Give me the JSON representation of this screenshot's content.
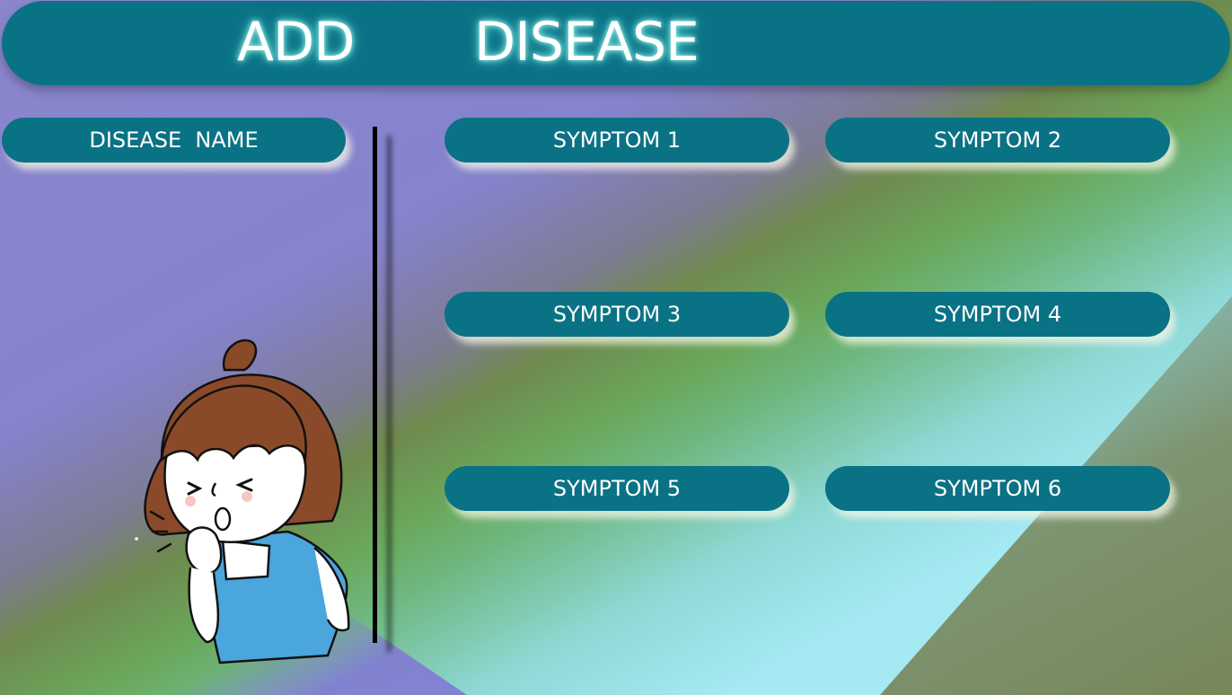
{
  "header": {
    "word_1": "ADD",
    "word_2": "DISEASE"
  },
  "fields": {
    "disease_name": "DISEASE  NAME",
    "symptom_1": "SYMPTOM 1",
    "symptom_2": "SYMPTOM 2",
    "symptom_3": "SYMPTOM 3",
    "symptom_4": "SYMPTOM 4",
    "symptom_5": "SYMPTOM 5",
    "symptom_6": "SYMPTOM 6"
  },
  "colors": {
    "header_bg": "#0a7285",
    "pill_bg": "#0a7285",
    "text": "#ffffff",
    "background_purple": "#8179d2",
    "background_cyan": "#a5e9f3",
    "background_green": "#6aa85c"
  },
  "illustration": {
    "icon": "coughing-girl-illustration"
  }
}
